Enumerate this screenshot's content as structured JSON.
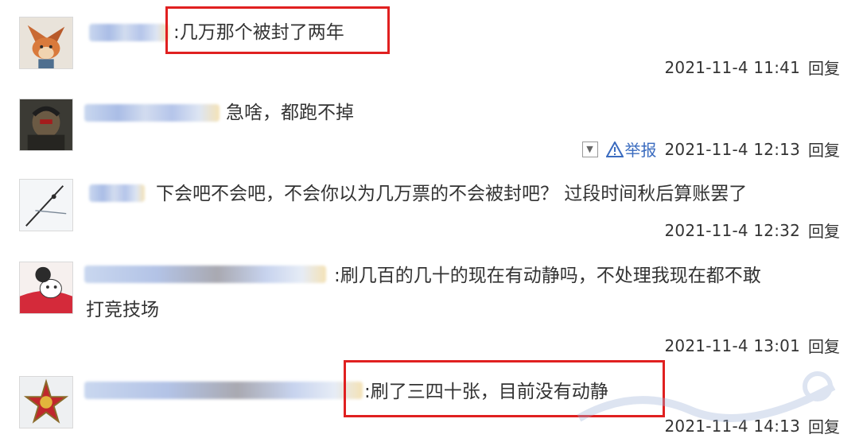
{
  "comments": [
    {
      "text": ":几万那个被封了两年",
      "timestamp": "2021-11-4 11:41",
      "reply": "回复"
    },
    {
      "text": "急啥，都跑不掉",
      "timestamp": "2021-11-4 12:13",
      "reply": "回复",
      "report": "举报"
    },
    {
      "text": "下会吧不会吧，不会你以为几万票的不会被封吧？ 过段时间秋后算账罢了",
      "timestamp": "2021-11-4 12:32",
      "reply": "回复"
    },
    {
      "text": ":刷几百的几十的现在有动静吗，不处理我现在都不敢",
      "text2": "打竞技场",
      "timestamp": "2021-11-4 13:01",
      "reply": "回复"
    },
    {
      "text": ":刷了三四十张，目前没有动静",
      "timestamp": "2021-11-4 14:13",
      "reply": "回复"
    }
  ]
}
